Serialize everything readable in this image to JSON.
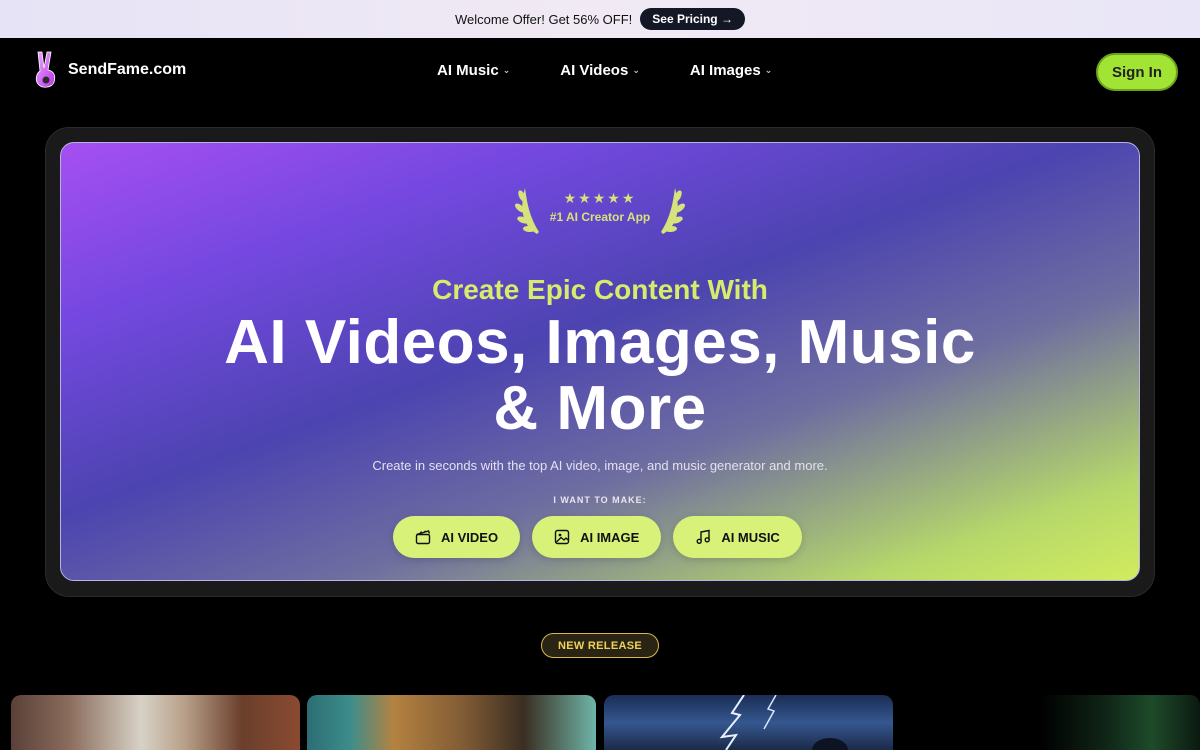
{
  "promo": {
    "text": "Welcome Offer! Get 56% OFF!",
    "button_label": "See Pricing →"
  },
  "nav": {
    "brand": "SendFame.com",
    "menu": [
      {
        "label": "AI Music"
      },
      {
        "label": "AI Videos"
      },
      {
        "label": "AI Images"
      }
    ],
    "signin_label": "Sign In"
  },
  "hero": {
    "award_stars": "★★★★★",
    "award_text": "#1 AI Creator App",
    "subtitle": "Create Epic Content With",
    "headline_line1": "AI Videos, Images, Music",
    "headline_line2": "& More",
    "description": "Create in seconds with the top AI video, image, and music generator and more.",
    "want_label": "I WANT TO MAKE:",
    "ctas": [
      {
        "label": "AI VIDEO",
        "icon": "clapperboard-icon"
      },
      {
        "label": "AI IMAGE",
        "icon": "image-icon"
      },
      {
        "label": "AI MUSIC",
        "icon": "music-note-icon"
      }
    ]
  },
  "release_badge": "NEW RELEASE",
  "colors": {
    "accent_green": "#a2e433",
    "cta_lime": "#d8f178",
    "subtitle_lime": "#d6ec6a",
    "badge_gold": "#f0d25a"
  }
}
